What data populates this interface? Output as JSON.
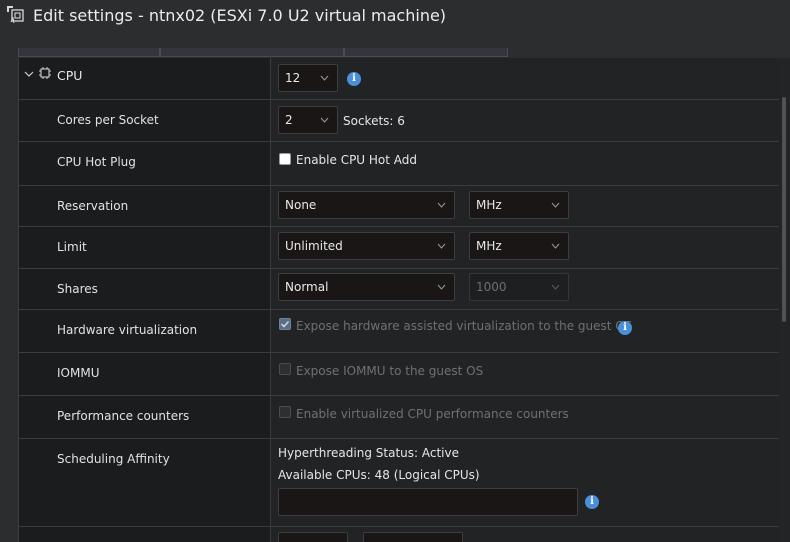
{
  "window": {
    "title": "Edit settings - ntnx02 (ESXi 7.0 U2 virtual machine)"
  },
  "cpu": {
    "section_label": "CPU",
    "value": "12",
    "cores_per_socket": {
      "label": "Cores per Socket",
      "value": "2",
      "sockets_text": "Sockets: 6"
    },
    "hot_plug": {
      "label": "CPU Hot Plug",
      "checkbox_label": "Enable CPU Hot Add",
      "checked": false
    },
    "reservation": {
      "label": "Reservation",
      "value": "None",
      "unit": "MHz"
    },
    "limit": {
      "label": "Limit",
      "value": "Unlimited",
      "unit": "MHz"
    },
    "shares": {
      "label": "Shares",
      "value": "Normal",
      "amount": "1000"
    },
    "hw_virt": {
      "label": "Hardware virtualization",
      "checkbox_label": "Expose hardware assisted virtualization to the guest OS",
      "checked": true
    },
    "iommu": {
      "label": "IOMMU",
      "checkbox_label": "Expose IOMMU to the guest OS",
      "checked": false
    },
    "perf": {
      "label": "Performance counters",
      "checkbox_label": "Enable virtualized CPU performance counters",
      "checked": false
    },
    "affinity": {
      "label": "Scheduling Affinity",
      "hyperthreading": "Hyperthreading Status: Active",
      "available": "Available CPUs: 48 (Logical CPUs)",
      "input_value": ""
    }
  },
  "icons": {
    "title": "vm-settings-icon",
    "section": "cpu-chip-icon",
    "info": "info-icon"
  },
  "colors": {
    "info": "#4a90d9",
    "panel": "#1b1c1d",
    "field": "#1b1616"
  }
}
